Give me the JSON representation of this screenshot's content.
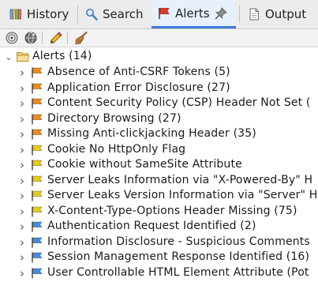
{
  "tabs": [
    {
      "label": "History",
      "icon": "history-icon"
    },
    {
      "label": "Search",
      "icon": "search-icon"
    },
    {
      "label": "Alerts",
      "icon": "red-flag-icon",
      "active": true
    },
    {
      "label": "Output",
      "icon": "document-icon"
    }
  ],
  "toolbar": {
    "buttons": [
      "scan-target-icon",
      "globe-scan-icon",
      "pencil-edit-icon",
      "broom-clear-icon"
    ]
  },
  "tree": {
    "root_label": "Alerts (14)",
    "items": [
      {
        "label": "Absence of Anti-CSRF Tokens (5)",
        "risk": "medium"
      },
      {
        "label": "Application Error Disclosure (27)",
        "risk": "medium"
      },
      {
        "label": "Content Security Policy (CSP) Header Not Set (",
        "risk": "medium"
      },
      {
        "label": "Directory Browsing (27)",
        "risk": "medium"
      },
      {
        "label": "Missing Anti-clickjacking Header (35)",
        "risk": "medium"
      },
      {
        "label": "Cookie No HttpOnly Flag",
        "risk": "low"
      },
      {
        "label": "Cookie without SameSite Attribute",
        "risk": "low"
      },
      {
        "label": "Server Leaks Information via \"X-Powered-By\" H",
        "risk": "low"
      },
      {
        "label": "Server Leaks Version Information via \"Server\" H",
        "risk": "low"
      },
      {
        "label": "X-Content-Type-Options Header Missing (75)",
        "risk": "low"
      },
      {
        "label": "Authentication Request Identified (2)",
        "risk": "informational"
      },
      {
        "label": "Information Disclosure - Suspicious Comments",
        "risk": "informational"
      },
      {
        "label": "Session Management Response Identified (16)",
        "risk": "informational"
      },
      {
        "label": "User Controllable HTML Element Attribute (Pot",
        "risk": "informational"
      }
    ]
  },
  "colors": {
    "medium": "#f08a1c",
    "low": "#e8cc1a",
    "informational": "#3f8ee0",
    "high": "#e03b2a",
    "active_tab_underline": "#3b7ad8"
  }
}
